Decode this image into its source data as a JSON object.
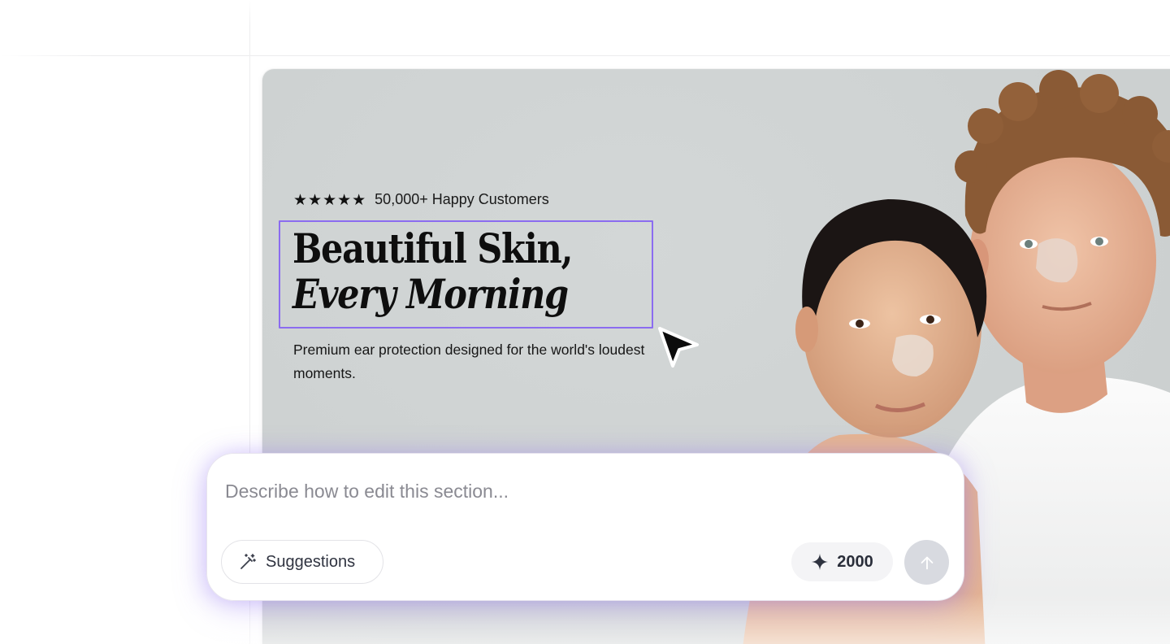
{
  "hero": {
    "stars": "★★★★★",
    "rating_text": "50,000+ Happy Customers",
    "headline_line1": "Beautiful Skin,",
    "headline_line2": "Every Morning",
    "description": "Premium ear protection designed for the world's loudest moments."
  },
  "prompt": {
    "placeholder": "Describe how to edit this section...",
    "suggestions_label": "Suggestions",
    "credits": "2000"
  },
  "colors": {
    "selection": "#8b6cf0",
    "hero_bg": "#cfd3d3",
    "send_disabled": "#d8dae0"
  },
  "icons": {
    "rating": "star-icon",
    "suggestions": "magic-wand-icon",
    "credits": "sparkle-icon",
    "send": "arrow-up-icon",
    "cursor": "mouse-pointer-icon"
  }
}
